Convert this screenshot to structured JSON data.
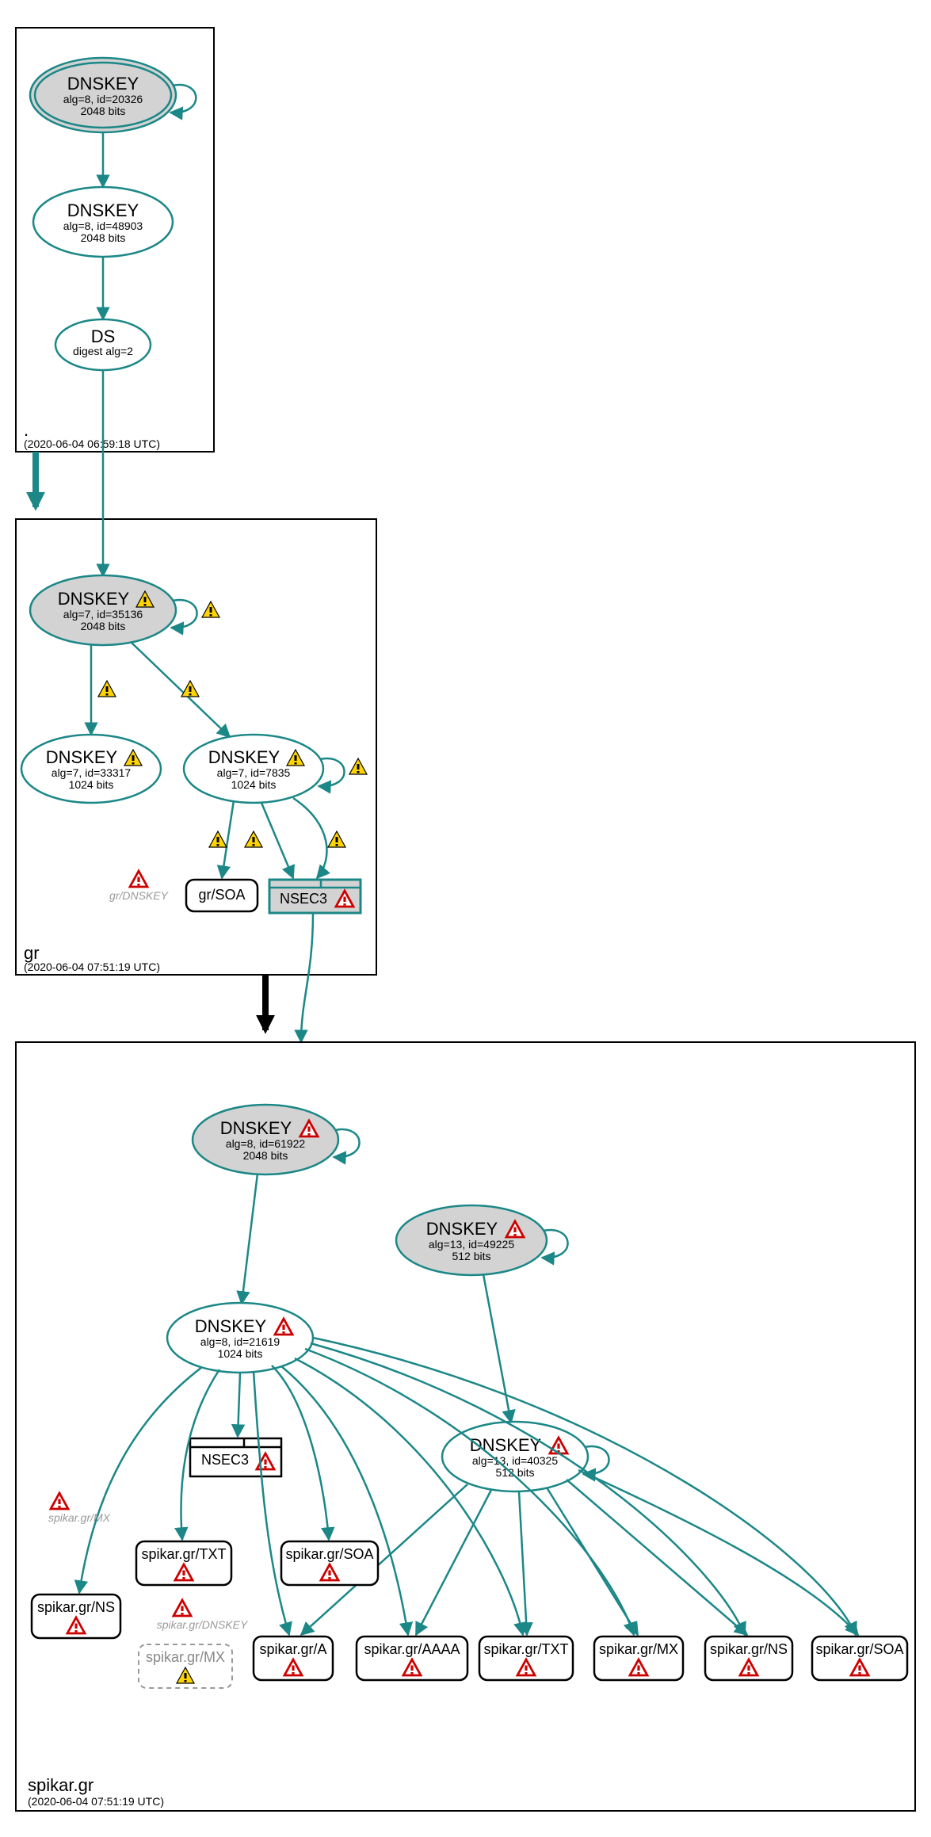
{
  "chart_data": {
    "type": "diagram",
    "description": "DNSSEC authentication chain / DNSViz-style graph for spikar.gr",
    "zones": [
      {
        "id": "root",
        "name": ".",
        "timestamp": "(2020-06-04 06:59:18 UTC)"
      },
      {
        "id": "gr",
        "name": "gr",
        "timestamp": "(2020-06-04 07:51:19 UTC)"
      },
      {
        "id": "spikar",
        "name": "spikar.gr",
        "timestamp": "(2020-06-04 07:51:19 UTC)"
      }
    ],
    "nodes": [
      {
        "id": "root_ksk",
        "zone": "root",
        "type": "DNSKEY",
        "fill": "grey",
        "double": true,
        "title": "DNSKEY",
        "line2": "alg=8, id=20326",
        "line3": "2048 bits",
        "warn": null
      },
      {
        "id": "root_zsk",
        "zone": "root",
        "type": "DNSKEY",
        "fill": "white",
        "double": false,
        "title": "DNSKEY",
        "line2": "alg=8, id=48903",
        "line3": "2048 bits",
        "warn": null
      },
      {
        "id": "root_ds",
        "zone": "root",
        "type": "DS",
        "fill": "white",
        "double": false,
        "title": "DS",
        "line2": "digest alg=2",
        "line3": null,
        "warn": null
      },
      {
        "id": "gr_ksk",
        "zone": "gr",
        "type": "DNSKEY",
        "fill": "grey",
        "double": false,
        "title": "DNSKEY",
        "line2": "alg=7, id=35136",
        "line3": "2048 bits",
        "warn": "yellow"
      },
      {
        "id": "gr_zsk1",
        "zone": "gr",
        "type": "DNSKEY",
        "fill": "white",
        "double": false,
        "title": "DNSKEY",
        "line2": "alg=7, id=33317",
        "line3": "1024 bits",
        "warn": "yellow"
      },
      {
        "id": "gr_zsk2",
        "zone": "gr",
        "type": "DNSKEY",
        "fill": "white",
        "double": false,
        "title": "DNSKEY",
        "line2": "alg=7, id=7835",
        "line3": "1024 bits",
        "warn": "yellow"
      },
      {
        "id": "gr_soa",
        "zone": "gr",
        "type": "RR",
        "title": "gr/SOA",
        "warn": null
      },
      {
        "id": "gr_nsec3",
        "zone": "gr",
        "type": "NSEC3",
        "title": "NSEC3",
        "warn": "red",
        "style": "teal"
      },
      {
        "id": "gr_dnskey_ghost",
        "zone": "gr",
        "type": "ghost",
        "title": "gr/DNSKEY",
        "warn": "red"
      },
      {
        "id": "sp_ksk1",
        "zone": "spikar",
        "type": "DNSKEY",
        "fill": "grey",
        "double": false,
        "title": "DNSKEY",
        "line2": "alg=8, id=61922",
        "line3": "2048 bits",
        "warn": "red"
      },
      {
        "id": "sp_ksk2",
        "zone": "spikar",
        "type": "DNSKEY",
        "fill": "grey",
        "double": false,
        "title": "DNSKEY",
        "line2": "alg=13, id=49225",
        "line3": "512 bits",
        "warn": "red"
      },
      {
        "id": "sp_zsk1",
        "zone": "spikar",
        "type": "DNSKEY",
        "fill": "white",
        "double": false,
        "title": "DNSKEY",
        "line2": "alg=8, id=21619",
        "line3": "1024 bits",
        "warn": "red"
      },
      {
        "id": "sp_zsk2",
        "zone": "spikar",
        "type": "DNSKEY",
        "fill": "white",
        "double": false,
        "title": "DNSKEY",
        "line2": "alg=13, id=40325",
        "line3": "512 bits",
        "warn": "red"
      },
      {
        "id": "sp_nsec3",
        "zone": "spikar",
        "type": "NSEC3",
        "title": "NSEC3",
        "warn": "red",
        "style": "black"
      },
      {
        "id": "sp_txt_a",
        "zone": "spikar",
        "type": "RR",
        "title": "spikar.gr/TXT",
        "warn": "red"
      },
      {
        "id": "sp_soa_a",
        "zone": "spikar",
        "type": "RR",
        "title": "spikar.gr/SOA",
        "warn": "red"
      },
      {
        "id": "sp_ns_a",
        "zone": "spikar",
        "type": "RR",
        "title": "spikar.gr/NS",
        "warn": "red"
      },
      {
        "id": "sp_mx_d",
        "zone": "spikar",
        "type": "RRdashed",
        "title": "spikar.gr/MX",
        "warn": "yellow"
      },
      {
        "id": "sp_a",
        "zone": "spikar",
        "type": "RR",
        "title": "spikar.gr/A",
        "warn": "red"
      },
      {
        "id": "sp_aaaa",
        "zone": "spikar",
        "type": "RR",
        "title": "spikar.gr/AAAA",
        "warn": "red"
      },
      {
        "id": "sp_txt_b",
        "zone": "spikar",
        "type": "RR",
        "title": "spikar.gr/TXT",
        "warn": "red"
      },
      {
        "id": "sp_mx_b",
        "zone": "spikar",
        "type": "RR",
        "title": "spikar.gr/MX",
        "warn": "red"
      },
      {
        "id": "sp_ns_b",
        "zone": "spikar",
        "type": "RR",
        "title": "spikar.gr/NS",
        "warn": "red"
      },
      {
        "id": "sp_soa_b",
        "zone": "spikar",
        "type": "RR",
        "title": "spikar.gr/SOA",
        "warn": "red"
      },
      {
        "id": "sp_mx_ghost",
        "zone": "spikar",
        "type": "ghost",
        "title": "spikar.gr/MX",
        "warn": "red"
      },
      {
        "id": "sp_dnskey_ghost",
        "zone": "spikar",
        "type": "ghost",
        "title": "spikar.gr/DNSKEY",
        "warn": "red"
      }
    ],
    "edges": [
      {
        "from": "root_ksk",
        "to": "root_ksk",
        "self": true
      },
      {
        "from": "root_ksk",
        "to": "root_zsk"
      },
      {
        "from": "root_zsk",
        "to": "root_ds"
      },
      {
        "from": "root_ds",
        "to": "gr_ksk"
      },
      {
        "from": "root_zone",
        "to": "gr_zone",
        "thick": true,
        "color": "teal"
      },
      {
        "from": "gr_ksk",
        "to": "gr_ksk",
        "self": true,
        "warn": "yellow"
      },
      {
        "from": "gr_ksk",
        "to": "gr_zsk1",
        "warn": "yellow"
      },
      {
        "from": "gr_ksk",
        "to": "gr_zsk2",
        "warn": "yellow"
      },
      {
        "from": "gr_zsk2",
        "to": "gr_zsk2",
        "self": true,
        "warn": "yellow"
      },
      {
        "from": "gr_zsk2",
        "to": "gr_soa",
        "warn": "yellow"
      },
      {
        "from": "gr_zsk2",
        "to": "gr_nsec3",
        "warn": "yellow",
        "count": 2
      },
      {
        "from": "gr_nsec3",
        "to": "spikar_zone"
      },
      {
        "from": "gr_zone",
        "to": "spikar_zone",
        "thick": true,
        "color": "black"
      },
      {
        "from": "sp_ksk1",
        "to": "sp_ksk1",
        "self": true
      },
      {
        "from": "sp_ksk1",
        "to": "sp_zsk1"
      },
      {
        "from": "sp_ksk2",
        "to": "sp_ksk2",
        "self": true
      },
      {
        "from": "sp_ksk2",
        "to": "sp_zsk2"
      },
      {
        "from": "sp_zsk1",
        "to": "sp_nsec3"
      },
      {
        "from": "sp_zsk1",
        "to": "sp_txt_a"
      },
      {
        "from": "sp_zsk1",
        "to": "sp_soa_a"
      },
      {
        "from": "sp_zsk1",
        "to": "sp_ns_a"
      },
      {
        "from": "sp_zsk1",
        "to": "sp_a"
      },
      {
        "from": "sp_zsk1",
        "to": "sp_aaaa"
      },
      {
        "from": "sp_zsk1",
        "to": "sp_txt_b"
      },
      {
        "from": "sp_zsk1",
        "to": "sp_mx_b"
      },
      {
        "from": "sp_zsk1",
        "to": "sp_ns_b"
      },
      {
        "from": "sp_zsk1",
        "to": "sp_soa_b"
      },
      {
        "from": "sp_zsk2",
        "to": "sp_zsk2",
        "self": true
      },
      {
        "from": "sp_zsk2",
        "to": "sp_a"
      },
      {
        "from": "sp_zsk2",
        "to": "sp_aaaa"
      },
      {
        "from": "sp_zsk2",
        "to": "sp_txt_b"
      },
      {
        "from": "sp_zsk2",
        "to": "sp_mx_b"
      },
      {
        "from": "sp_zsk2",
        "to": "sp_ns_b"
      },
      {
        "from": "sp_zsk2",
        "to": "sp_soa_b"
      }
    ]
  },
  "zones": {
    "root": {
      "name": ".",
      "ts": "(2020-06-04 06:59:18 UTC)"
    },
    "gr": {
      "name": "gr",
      "ts": "(2020-06-04 07:51:19 UTC)"
    },
    "spikar": {
      "name": "spikar.gr",
      "ts": "(2020-06-04 07:51:19 UTC)"
    }
  },
  "labels": {
    "dnskey": "DNSKEY",
    "ds": "DS",
    "nsec3": "NSEC3",
    "gr_soa": "gr/SOA",
    "gr_dnskey_ghost": "gr/DNSKEY",
    "sp_mx_ghost": "spikar.gr/MX",
    "sp_dnskey_ghost": "spikar.gr/DNSKEY",
    "sp_txt": "spikar.gr/TXT",
    "sp_soa": "spikar.gr/SOA",
    "sp_ns": "spikar.gr/NS",
    "sp_mx": "spikar.gr/MX",
    "sp_a": "spikar.gr/A",
    "sp_aaaa": "spikar.gr/AAAA"
  },
  "details": {
    "root_ksk": {
      "l2": "alg=8, id=20326",
      "l3": "2048 bits"
    },
    "root_zsk": {
      "l2": "alg=8, id=48903",
      "l3": "2048 bits"
    },
    "root_ds": {
      "l2": "digest alg=2"
    },
    "gr_ksk": {
      "l2": "alg=7, id=35136",
      "l3": "2048 bits"
    },
    "gr_zsk1": {
      "l2": "alg=7, id=33317",
      "l3": "1024 bits"
    },
    "gr_zsk2": {
      "l2": "alg=7, id=7835",
      "l3": "1024 bits"
    },
    "sp_ksk1": {
      "l2": "alg=8, id=61922",
      "l3": "2048 bits"
    },
    "sp_ksk2": {
      "l2": "alg=13, id=49225",
      "l3": "512 bits"
    },
    "sp_zsk1": {
      "l2": "alg=8, id=21619",
      "l3": "1024 bits"
    },
    "sp_zsk2": {
      "l2": "alg=13, id=40325",
      "l3": "512 bits"
    }
  }
}
